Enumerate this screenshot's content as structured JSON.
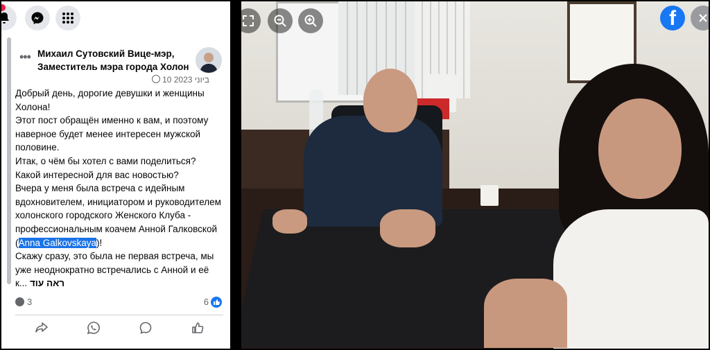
{
  "post": {
    "author": "Михаил Сутовский Вице-мэр, Заместитель мэра города Холон",
    "date": "10 ביוני 2023",
    "text_lines": [
      "Добрый день, дорогие девушки и женщины Холона!",
      "Этот пост обращён именно к вам, и поэтому наверное будет менее интересен мужской половине.",
      "Итак, о чём бы хотел с вами поделиться? Какой интересной для вас новостью?",
      "Вчера у меня была встреча с идейным вдохновителем, инициатором и руководителем холонского городского Женского Клуба - профессиональным коачем Анной Галковской ("
    ],
    "mention": "Anna Galkovskaya",
    "after_mention": ")!",
    "text_line_last": "Скажу сразу, это была не первая встреча, мы уже неоднократно встречались с Анной и её к...",
    "see_more": "ראה עוד",
    "comments_count": "3",
    "likes_count": "6"
  },
  "icons": {
    "top": [
      "bell-icon",
      "messenger-icon",
      "apps-grid-icon"
    ],
    "actions": [
      "share-icon",
      "whatsapp-icon",
      "comment-icon",
      "like-icon"
    ],
    "viewer": [
      "fullscreen-icon",
      "zoom-out-icon",
      "zoom-in-icon"
    ]
  },
  "brand": {
    "facebook_blue": "#1877f2",
    "fb_letter": "f"
  }
}
